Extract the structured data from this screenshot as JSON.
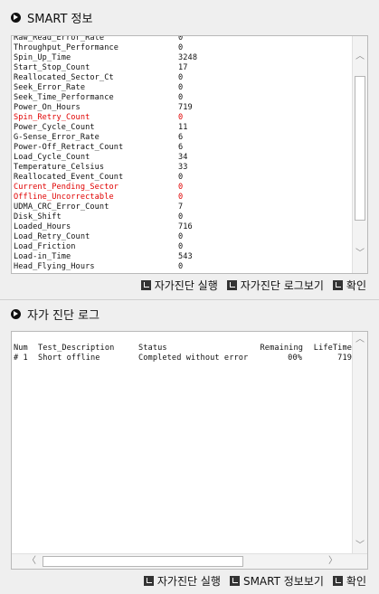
{
  "smart": {
    "title": "SMART 정보",
    "rows": [
      {
        "name": "Raw_Read_Error_Rate",
        "value": "0",
        "highlight": false
      },
      {
        "name": "Throughput_Performance",
        "value": "0",
        "highlight": false
      },
      {
        "name": "Spin_Up_Time",
        "value": "3248",
        "highlight": false
      },
      {
        "name": "Start_Stop_Count",
        "value": "17",
        "highlight": false
      },
      {
        "name": "Reallocated_Sector_Ct",
        "value": "0",
        "highlight": false
      },
      {
        "name": "Seek_Error_Rate",
        "value": "0",
        "highlight": false
      },
      {
        "name": "Seek_Time_Performance",
        "value": "0",
        "highlight": false
      },
      {
        "name": "Power_On_Hours",
        "value": "719",
        "highlight": false
      },
      {
        "name": "Spin_Retry_Count",
        "value": "0",
        "highlight": true
      },
      {
        "name": "Power_Cycle_Count",
        "value": "11",
        "highlight": false
      },
      {
        "name": "G-Sense_Error_Rate",
        "value": "6",
        "highlight": false
      },
      {
        "name": "Power-Off_Retract_Count",
        "value": "6",
        "highlight": false
      },
      {
        "name": "Load_Cycle_Count",
        "value": "34",
        "highlight": false
      },
      {
        "name": "Temperature_Celsius",
        "value": "33",
        "highlight": false
      },
      {
        "name": "Reallocated_Event_Count",
        "value": "0",
        "highlight": false
      },
      {
        "name": "Current_Pending_Sector",
        "value": "0",
        "highlight": true
      },
      {
        "name": "Offline_Uncorrectable",
        "value": "0",
        "highlight": true
      },
      {
        "name": "UDMA_CRC_Error_Count",
        "value": "7",
        "highlight": false
      },
      {
        "name": "Disk_Shift",
        "value": "0",
        "highlight": false
      },
      {
        "name": "Loaded_Hours",
        "value": "716",
        "highlight": false
      },
      {
        "name": "Load_Retry_Count",
        "value": "0",
        "highlight": false
      },
      {
        "name": "Load_Friction",
        "value": "0",
        "highlight": false
      },
      {
        "name": "Load-in_Time",
        "value": "543",
        "highlight": false
      },
      {
        "name": "Head_Flying_Hours",
        "value": "0",
        "highlight": false
      }
    ],
    "buttons": {
      "run_selftest": "자가진단 실행",
      "view_log": "자가진단 로그보기",
      "ok": "확인"
    }
  },
  "log": {
    "title": "자가 진단 로그",
    "headers": {
      "num": "Num",
      "desc": "Test_Description",
      "status": "Status",
      "remaining": "Remaining",
      "lifetime": "LifeTime"
    },
    "entries": [
      {
        "num": "# 1",
        "desc": "Short offline",
        "status": "Completed without error",
        "remaining": "00%",
        "lifetime": "719"
      }
    ],
    "buttons": {
      "run_selftest": "자가진단 실행",
      "view_smart": "SMART 정보보기",
      "ok": "확인"
    }
  },
  "colors": {
    "highlight": "#e00000"
  },
  "icons": {
    "section_bullet": "play-circle-icon",
    "button": "corner-arrow-icon"
  }
}
